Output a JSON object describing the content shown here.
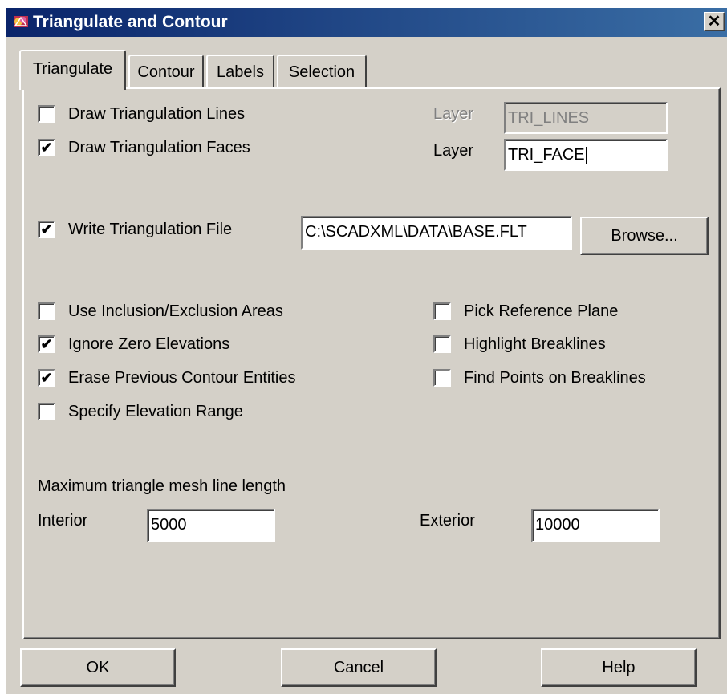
{
  "window": {
    "title": "Triangulate and Contour",
    "close_label": "✕"
  },
  "tabs": [
    {
      "label": "Triangulate",
      "active": true
    },
    {
      "label": "Contour",
      "active": false
    },
    {
      "label": "Labels",
      "active": false
    },
    {
      "label": "Selection",
      "active": false
    }
  ],
  "triangulate": {
    "draw_lines": {
      "label": "Draw Triangulation Lines",
      "checked": false
    },
    "draw_faces": {
      "label": "Draw Triangulation Faces",
      "checked": true
    },
    "lines_layer": {
      "label": "Layer",
      "value": "TRI_LINES",
      "enabled": false
    },
    "faces_layer": {
      "label": "Layer",
      "value": "TRI_FACE",
      "enabled": true
    },
    "write_file": {
      "label": "Write Triangulation File",
      "checked": true
    },
    "file_path": "C:\\SCADXML\\DATA\\BASE.FLT",
    "browse_label": "Browse...",
    "options_left": [
      {
        "label": "Use Inclusion/Exclusion Areas",
        "checked": false
      },
      {
        "label": "Ignore Zero Elevations",
        "checked": true
      },
      {
        "label": "Erase Previous Contour Entities",
        "checked": true
      },
      {
        "label": "Specify Elevation Range",
        "checked": false
      }
    ],
    "options_right": [
      {
        "label": "Pick Reference Plane",
        "checked": false
      },
      {
        "label": "Highlight Breaklines",
        "checked": false
      },
      {
        "label": "Find Points on Breaklines",
        "checked": false
      }
    ],
    "mesh_heading": "Maximum triangle mesh line length",
    "interior": {
      "label": "Interior",
      "value": "5000"
    },
    "exterior": {
      "label": "Exterior",
      "value": "10000"
    }
  },
  "buttons": {
    "ok": "OK",
    "cancel": "Cancel",
    "help": "Help"
  },
  "check_glyph": "✔"
}
